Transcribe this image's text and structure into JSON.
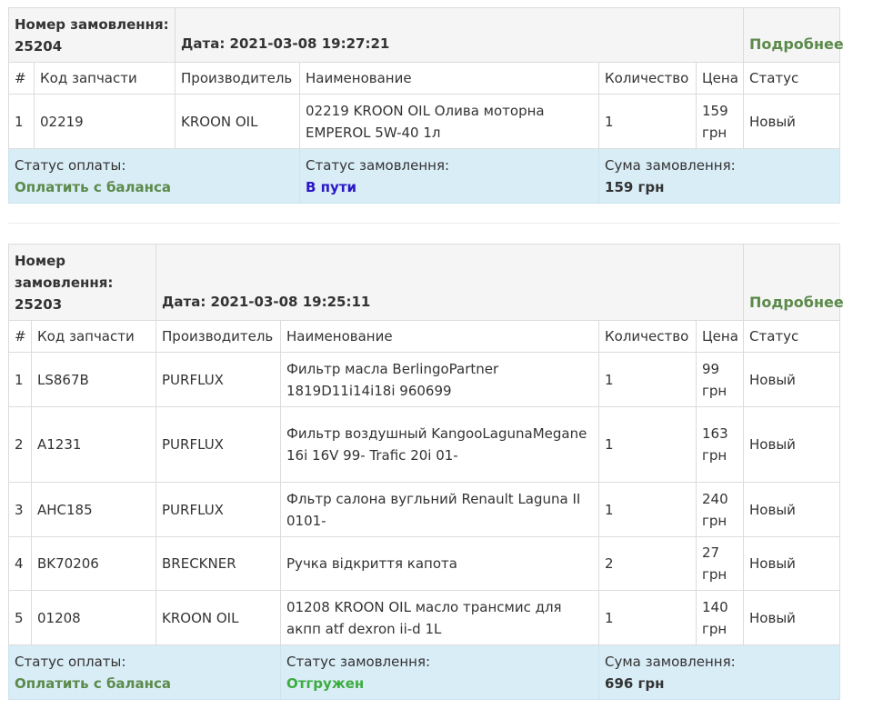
{
  "orders": [
    {
      "order_label": "Номер замовлення:",
      "order_number": "25204",
      "date": "Дата: 2021-03-08 19:27:21",
      "details_link": "Подробнее",
      "columns": [
        "#",
        "Код запчасти",
        "Производитель",
        "Наименование",
        "Количество",
        "Цена",
        "Статус"
      ],
      "items": [
        {
          "n": "1",
          "code": "02219",
          "maker": "KROON OIL",
          "name": "02219 KROON OIL Олива моторна EMPEROL 5W-40 1л",
          "qty": "1",
          "price": "159 грн",
          "status": "Новый"
        }
      ],
      "payment_label": "Статус оплаты:",
      "payment_value": "Оплатить с баланса",
      "order_status_label": "Статус замовлення:",
      "order_status_value": "В пути",
      "sum_label": "Сума замовлення:",
      "sum_value": "159 грн"
    },
    {
      "order_label": "Номер замовлення:",
      "order_number": "25203",
      "date": "Дата: 2021-03-08 19:25:11",
      "details_link": "Подробнее",
      "columns": [
        "#",
        "Код запчасти",
        "Производитель",
        "Наименование",
        "Количество",
        "Цена",
        "Статус"
      ],
      "items": [
        {
          "n": "1",
          "code": "LS867B",
          "maker": "PURFLUX",
          "name": "Фильтр масла BerlingoPartner 1819D11i14i18i 960699",
          "qty": "1",
          "price": "99 грн",
          "status": "Новый"
        },
        {
          "n": "2",
          "code": "A1231",
          "maker": "PURFLUX",
          "name": "Фильтр воздушный KangooLagunaMegane 16i 16V 99- Trafic 20i 01-",
          "qty": "1",
          "price": "163 грн",
          "status": "Новый"
        },
        {
          "n": "3",
          "code": "AHC185",
          "maker": "PURFLUX",
          "name": "Фльтр салона вугльний Renault Laguna II 0101-",
          "qty": "1",
          "price": "240 грн",
          "status": "Новый"
        },
        {
          "n": "4",
          "code": "BK70206",
          "maker": "BRECKNER",
          "name": "Ручка відкриття капота",
          "qty": "2",
          "price": "27 грн",
          "status": "Новый"
        },
        {
          "n": "5",
          "code": "01208",
          "maker": "KROON OIL",
          "name": "01208 KROON OIL масло трансмис для акпп atf dexron ii-d 1L",
          "qty": "1",
          "price": "140 грн",
          "status": "Новый"
        }
      ],
      "payment_label": "Статус оплаты:",
      "payment_value": "Оплатить с баланса",
      "order_status_label": "Статус замовлення:",
      "order_status_value": "Отгружен",
      "sum_label": "Сума замовлення:",
      "sum_value": "696 грн"
    }
  ]
}
